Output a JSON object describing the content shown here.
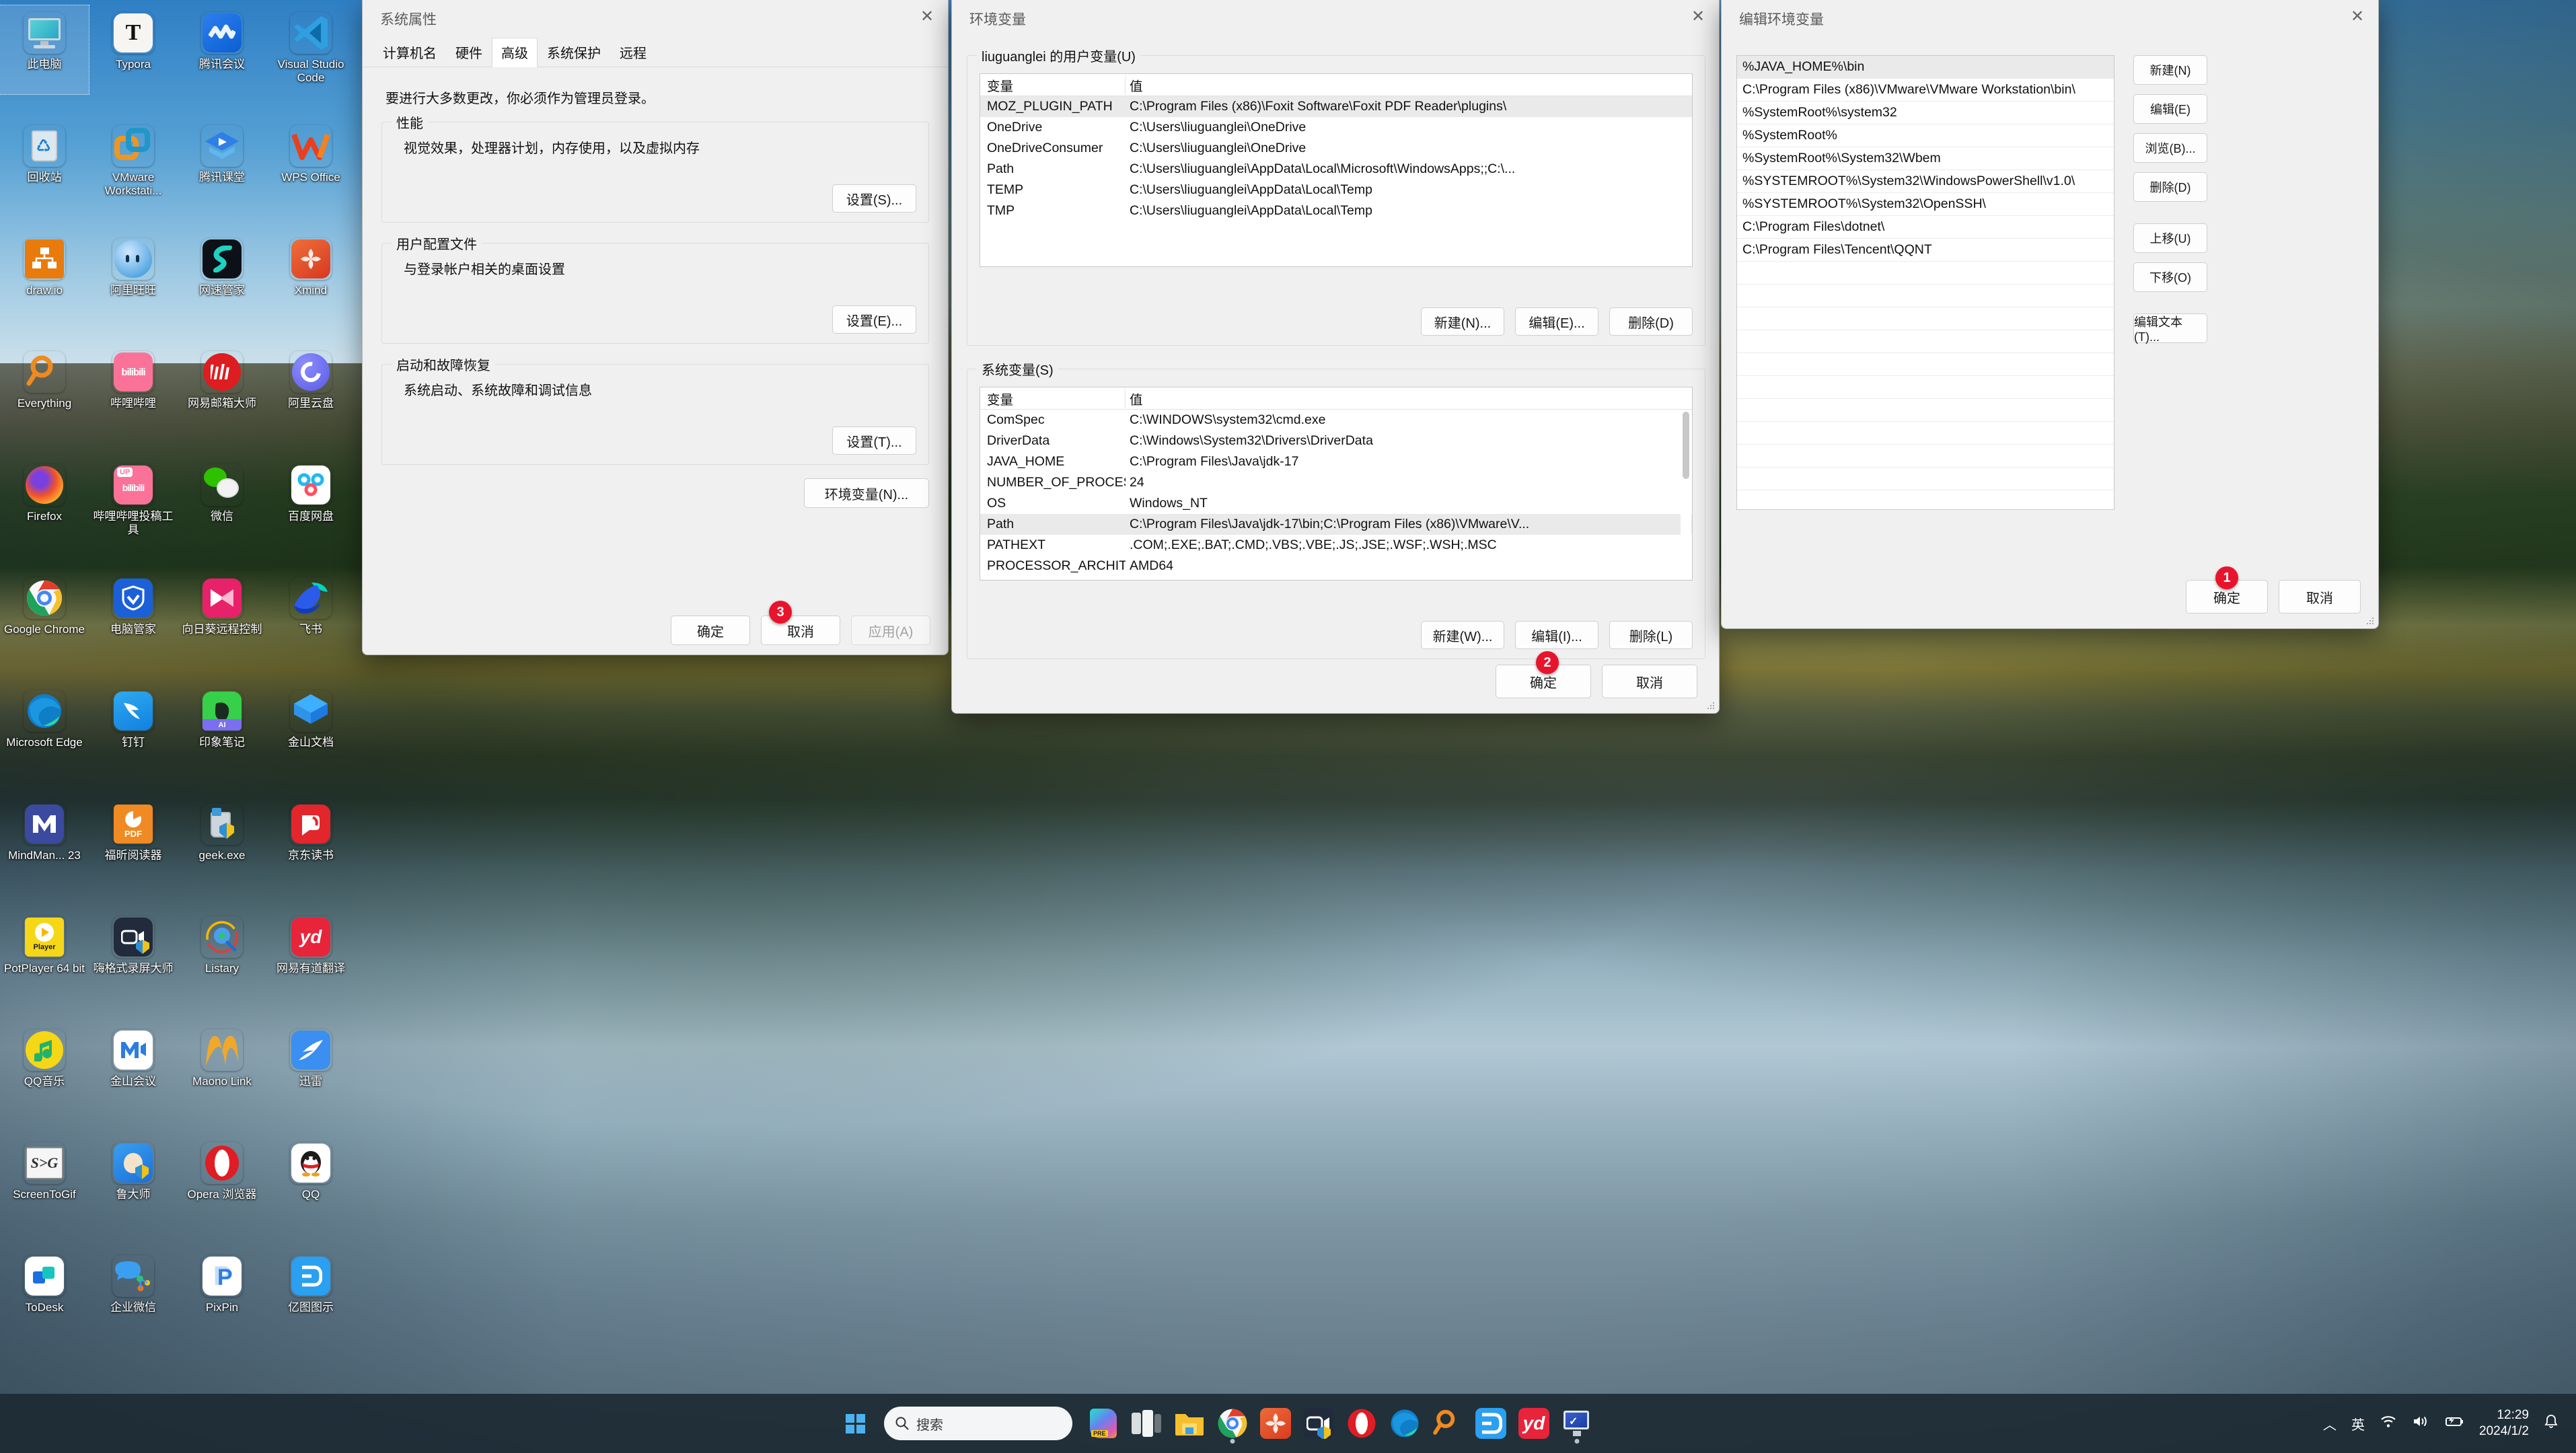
{
  "desktop": {
    "icons": [
      {
        "label": "此电脑",
        "icon": "this-pc-icon",
        "selected": true
      },
      {
        "label": "Typora",
        "icon": "typora-icon"
      },
      {
        "label": "腾讯会议",
        "icon": "tencent-meeting-icon"
      },
      {
        "label": "Visual Studio Code",
        "icon": "vscode-icon"
      },
      {
        "label": "回收站",
        "icon": "recycle-bin-icon"
      },
      {
        "label": "VMware Workstati...",
        "icon": "vmware-icon"
      },
      {
        "label": "腾讯课堂",
        "icon": "tencent-ketang-icon"
      },
      {
        "label": "WPS Office",
        "icon": "wps-office-icon"
      },
      {
        "label": "draw.io",
        "icon": "drawio-icon"
      },
      {
        "label": "阿里旺旺",
        "icon": "aliwangwang-icon"
      },
      {
        "label": "网速管家",
        "icon": "netspeed-icon"
      },
      {
        "label": "Xmind",
        "icon": "xmind-icon"
      },
      {
        "label": "Everything",
        "icon": "everything-icon"
      },
      {
        "label": "哔哩哔哩",
        "icon": "bilibili-icon"
      },
      {
        "label": "网易邮箱大师",
        "icon": "netease-mail-icon"
      },
      {
        "label": "阿里云盘",
        "icon": "aliyun-drive-icon"
      },
      {
        "label": "Firefox",
        "icon": "firefox-icon"
      },
      {
        "label": "哔哩哔哩投稿工具",
        "icon": "bilibili-upload-icon"
      },
      {
        "label": "微信",
        "icon": "wechat-icon"
      },
      {
        "label": "百度网盘",
        "icon": "baidu-netdisk-icon"
      },
      {
        "label": "Google Chrome",
        "icon": "chrome-icon"
      },
      {
        "label": "电脑管家",
        "icon": "pc-manager-icon"
      },
      {
        "label": "向日葵远程控制",
        "icon": "sunflower-remote-icon"
      },
      {
        "label": "飞书",
        "icon": "feishu-icon"
      },
      {
        "label": "Microsoft Edge",
        "icon": "edge-icon"
      },
      {
        "label": "钉钉",
        "icon": "dingtalk-icon"
      },
      {
        "label": "印象笔记",
        "icon": "evernote-icon"
      },
      {
        "label": "金山文档",
        "icon": "kingsoft-docs-icon"
      },
      {
        "label": "MindMan... 23",
        "icon": "mindmanager-icon"
      },
      {
        "label": "福昕阅读器",
        "icon": "foxit-reader-icon"
      },
      {
        "label": "geek.exe",
        "icon": "geek-uninstaller-icon"
      },
      {
        "label": "京东读书",
        "icon": "jd-read-icon"
      },
      {
        "label": "PotPlayer 64 bit",
        "icon": "potplayer-icon"
      },
      {
        "label": "嗨格式录屏大师",
        "icon": "higeshi-recorder-icon"
      },
      {
        "label": "Listary",
        "icon": "listary-icon"
      },
      {
        "label": "网易有道翻译",
        "icon": "youdao-translate-icon"
      },
      {
        "label": "QQ音乐",
        "icon": "qq-music-icon"
      },
      {
        "label": "金山会议",
        "icon": "kingsoft-meeting-icon"
      },
      {
        "label": "Maono Link",
        "icon": "maono-link-icon"
      },
      {
        "label": "迅雷",
        "icon": "thunder-icon"
      },
      {
        "label": "ScreenToGif",
        "icon": "screentogif-icon"
      },
      {
        "label": "鲁大师",
        "icon": "ludashi-icon"
      },
      {
        "label": "Opera 浏览器",
        "icon": "opera-icon"
      },
      {
        "label": "QQ",
        "icon": "qq-icon"
      },
      {
        "label": "ToDesk",
        "icon": "todesk-icon"
      },
      {
        "label": "企业微信",
        "icon": "wecom-icon"
      },
      {
        "label": "PixPin",
        "icon": "pixpin-icon"
      },
      {
        "label": "亿图图示",
        "icon": "edraw-icon"
      }
    ]
  },
  "system_properties": {
    "title": "系统属性",
    "close_label": "✕",
    "tabs": [
      {
        "label": "计算机名",
        "active": false
      },
      {
        "label": "硬件",
        "active": false
      },
      {
        "label": "高级",
        "active": true
      },
      {
        "label": "系统保护",
        "active": false
      },
      {
        "label": "远程",
        "active": false
      }
    ],
    "note": "要进行大多数更改，你必须作为管理员登录。",
    "groups": [
      {
        "legend": "性能",
        "desc": "视觉效果，处理器计划，内存使用，以及虚拟内存",
        "button": "设置(S)..."
      },
      {
        "legend": "用户配置文件",
        "desc": "与登录帐户相关的桌面设置",
        "button": "设置(E)..."
      },
      {
        "legend": "启动和故障恢复",
        "desc": "系统启动、系统故障和调试信息",
        "button": "设置(T)..."
      }
    ],
    "env_button": "环境变量(N)...",
    "footer": {
      "ok": "确定",
      "cancel": "取消",
      "apply": "应用(A)"
    },
    "badge": "3"
  },
  "environment_variables": {
    "title": "环境变量",
    "close_label": "✕",
    "user_section": {
      "legend": "liuguanglei 的用户变量(U)",
      "columns": [
        "变量",
        "值"
      ],
      "rows": [
        {
          "name": "MOZ_PLUGIN_PATH",
          "value": "C:\\Program Files (x86)\\Foxit Software\\Foxit PDF Reader\\plugins\\",
          "selected": true
        },
        {
          "name": "OneDrive",
          "value": "C:\\Users\\liuguanglei\\OneDrive",
          "selected": false
        },
        {
          "name": "OneDriveConsumer",
          "value": "C:\\Users\\liuguanglei\\OneDrive",
          "selected": false
        },
        {
          "name": "Path",
          "value": "C:\\Users\\liuguanglei\\AppData\\Local\\Microsoft\\WindowsApps;;C:\\...",
          "selected": false
        },
        {
          "name": "TEMP",
          "value": "C:\\Users\\liuguanglei\\AppData\\Local\\Temp",
          "selected": false
        },
        {
          "name": "TMP",
          "value": "C:\\Users\\liuguanglei\\AppData\\Local\\Temp",
          "selected": false
        }
      ],
      "buttons": {
        "new": "新建(N)...",
        "edit": "编辑(E)...",
        "delete": "删除(D)"
      }
    },
    "system_section": {
      "legend": "系统变量(S)",
      "columns": [
        "变量",
        "值"
      ],
      "rows": [
        {
          "name": "ComSpec",
          "value": "C:\\WINDOWS\\system32\\cmd.exe",
          "selected": false
        },
        {
          "name": "DriverData",
          "value": "C:\\Windows\\System32\\Drivers\\DriverData",
          "selected": false
        },
        {
          "name": "JAVA_HOME",
          "value": "C:\\Program Files\\Java\\jdk-17",
          "selected": false
        },
        {
          "name": "NUMBER_OF_PROCESSORS",
          "value": "24",
          "selected": false
        },
        {
          "name": "OS",
          "value": "Windows_NT",
          "selected": false
        },
        {
          "name": "Path",
          "value": "C:\\Program Files\\Java\\jdk-17\\bin;C:\\Program Files (x86)\\VMware\\V...",
          "selected": true
        },
        {
          "name": "PATHEXT",
          "value": ".COM;.EXE;.BAT;.CMD;.VBS;.VBE;.JS;.JSE;.WSF;.WSH;.MSC",
          "selected": false
        },
        {
          "name": "PROCESSOR_ARCHITECTURE",
          "value": "AMD64",
          "selected": false
        }
      ],
      "buttons": {
        "new": "新建(W)...",
        "edit": "编辑(I)...",
        "delete": "删除(L)"
      }
    },
    "footer": {
      "ok": "确定",
      "cancel": "取消"
    },
    "badge": "2"
  },
  "edit_environment_variable": {
    "title": "编辑环境变量",
    "close_label": "✕",
    "entries": [
      {
        "value": "%JAVA_HOME%\\bin",
        "selected": true
      },
      {
        "value": "C:\\Program Files (x86)\\VMware\\VMware Workstation\\bin\\",
        "selected": false
      },
      {
        "value": "%SystemRoot%\\system32",
        "selected": false
      },
      {
        "value": "%SystemRoot%",
        "selected": false
      },
      {
        "value": "%SystemRoot%\\System32\\Wbem",
        "selected": false
      },
      {
        "value": "%SYSTEMROOT%\\System32\\WindowsPowerShell\\v1.0\\",
        "selected": false
      },
      {
        "value": "%SYSTEMROOT%\\System32\\OpenSSH\\",
        "selected": false
      },
      {
        "value": "C:\\Program Files\\dotnet\\",
        "selected": false
      },
      {
        "value": "C:\\Program Files\\Tencent\\QQNT",
        "selected": false
      }
    ],
    "empty_rows": 13,
    "side_buttons": [
      {
        "label": "新建(N)",
        "name": "new-button"
      },
      {
        "label": "编辑(E)",
        "name": "edit-button"
      },
      {
        "label": "浏览(B)...",
        "name": "browse-button"
      },
      {
        "label": "删除(D)",
        "name": "delete-button"
      },
      {
        "label": "上移(U)",
        "name": "move-up-button"
      },
      {
        "label": "下移(O)",
        "name": "move-down-button"
      },
      {
        "label": "编辑文本(T)...",
        "name": "edit-text-button"
      }
    ],
    "footer": {
      "ok": "确定",
      "cancel": "取消"
    },
    "badge": "1"
  },
  "taskbar": {
    "start_label": "开始",
    "search": {
      "placeholder": "搜索",
      "icon": "search-icon"
    },
    "items": [
      {
        "name": "copilot-icon",
        "label": "Copilot",
        "running": false
      },
      {
        "name": "task-view-icon",
        "label": "任务视图",
        "running": false
      },
      {
        "name": "file-explorer-icon",
        "label": "文件资源管理器",
        "running": false
      },
      {
        "name": "chrome-icon",
        "label": "Google Chrome",
        "running": true
      },
      {
        "name": "xmind-icon",
        "label": "Xmind",
        "running": false
      },
      {
        "name": "higeshi-recorder-icon",
        "label": "嗨格式录屏大师",
        "running": false
      },
      {
        "name": "opera-icon",
        "label": "Opera 浏览器",
        "running": false
      },
      {
        "name": "edge-icon",
        "label": "Microsoft Edge",
        "running": false
      },
      {
        "name": "everything-icon",
        "label": "Everything",
        "running": false
      },
      {
        "name": "edraw-icon",
        "label": "亿图图示",
        "running": false
      },
      {
        "name": "youdao-translate-icon",
        "label": "网易有道翻译",
        "running": false
      },
      {
        "name": "system-properties-icon",
        "label": "系统属性",
        "running": true
      }
    ],
    "tray": {
      "chevron": "︿",
      "ime": "英",
      "wifi": "wifi-icon",
      "volume": "volume-icon",
      "battery": "battery-icon",
      "time": "12:29",
      "date": "2024/1/2",
      "notifications": "bell-icon"
    }
  }
}
